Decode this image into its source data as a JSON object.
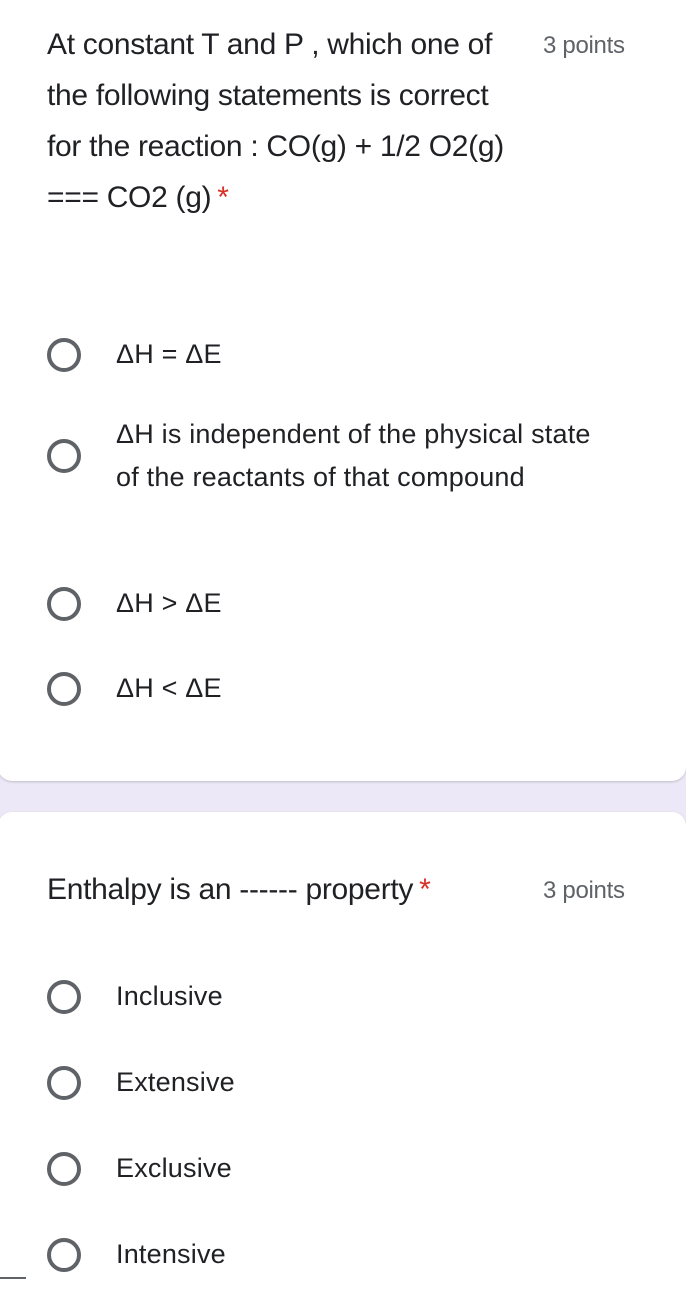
{
  "colors": {
    "background": "#ece8f7",
    "card": "#ffffff",
    "required_asterisk": "#d93025",
    "radio_border": "#5f6368",
    "text": "#202124",
    "points_text": "#5f6368"
  },
  "questions": [
    {
      "title": "At constant T and P , which one of the following statements is correct for the reaction : CO(g) + 1/2 O2(g) === CO2 (g)",
      "required_mark": "*",
      "points": "3 points",
      "options": [
        {
          "label": "ΔH = ΔE",
          "icon": "radio-unchecked-icon"
        },
        {
          "label": "ΔH is independent of the physical state of the reactants of that compound",
          "icon": "radio-unchecked-icon"
        },
        {
          "label": "ΔH > ΔE",
          "icon": "radio-unchecked-icon"
        },
        {
          "label": "ΔH < ΔE",
          "icon": "radio-unchecked-icon"
        }
      ]
    },
    {
      "title": "Enthalpy is an ------ property",
      "required_mark": "*",
      "points": "3 points",
      "options": [
        {
          "label": "Inclusive",
          "icon": "radio-unchecked-icon"
        },
        {
          "label": "Extensive",
          "icon": "radio-unchecked-icon"
        },
        {
          "label": "Exclusive",
          "icon": "radio-unchecked-icon"
        },
        {
          "label": "Intensive",
          "icon": "radio-unchecked-icon"
        }
      ]
    }
  ]
}
